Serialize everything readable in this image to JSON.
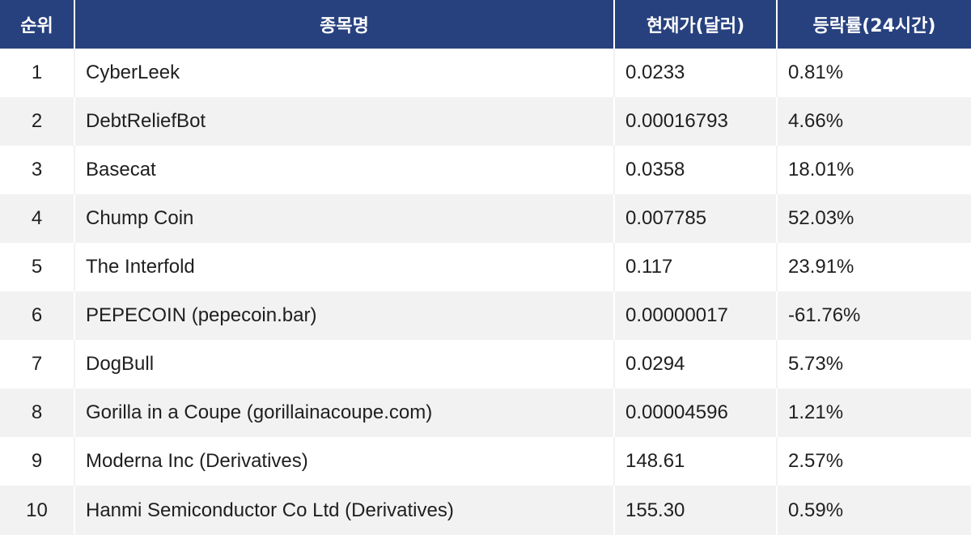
{
  "table": {
    "headers": [
      "순위",
      "종목명",
      "현재가(달러)",
      "등락률(24시간)"
    ],
    "rows": [
      {
        "rank": "1",
        "name": "CyberLeek",
        "price": "0.0233",
        "change": "0.81%"
      },
      {
        "rank": "2",
        "name": "DebtReliefBot",
        "price": "0.00016793",
        "change": "4.66%"
      },
      {
        "rank": "3",
        "name": "Basecat",
        "price": "0.0358",
        "change": "18.01%"
      },
      {
        "rank": "4",
        "name": "Chump Coin",
        "price": "0.007785",
        "change": "52.03%"
      },
      {
        "rank": "5",
        "name": "The Interfold",
        "price": "0.117",
        "change": "23.91%"
      },
      {
        "rank": "6",
        "name": "PEPECOIN (pepecoin.bar)",
        "price": "0.00000017",
        "change": "-61.76%"
      },
      {
        "rank": "7",
        "name": "DogBull",
        "price": "0.0294",
        "change": "5.73%"
      },
      {
        "rank": "8",
        "name": "Gorilla in a Coupe (gorillainacoupe.com)",
        "price": "0.00004596",
        "change": "1.21%"
      },
      {
        "rank": "9",
        "name": "Moderna Inc (Derivatives)",
        "price": "148.61",
        "change": "2.57%"
      },
      {
        "rank": "10",
        "name": "Hanmi Semiconductor Co Ltd (Derivatives)",
        "price": "155.30",
        "change": "0.59%"
      }
    ]
  },
  "colors": {
    "header_bg": "#27417f",
    "header_text": "#ffffff",
    "row_alt_bg": "#f2f2f2",
    "text": "#1f1f1f"
  }
}
